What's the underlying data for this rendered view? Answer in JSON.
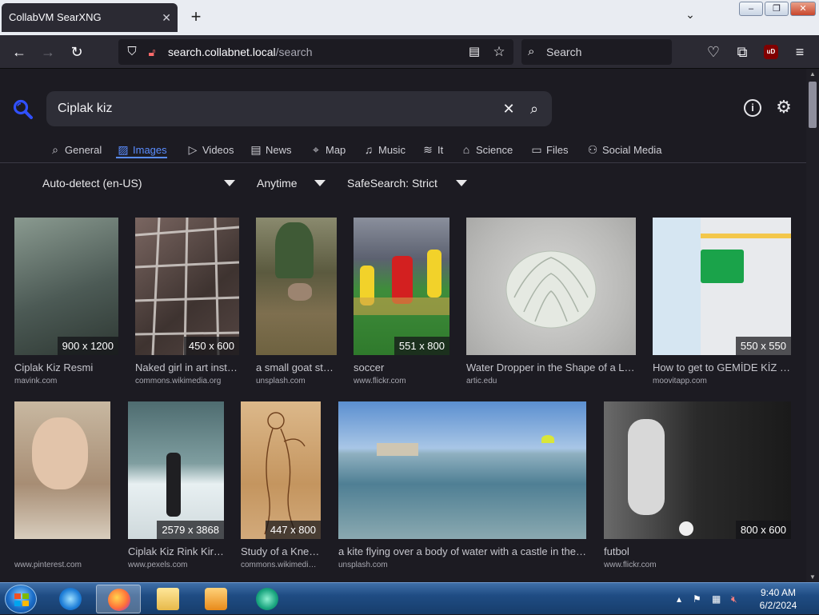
{
  "browser": {
    "tab_title": "CollabVM SearXNG",
    "tab_close": "✕",
    "new_tab": "+",
    "url_host": "search.collabnet.local",
    "url_path": "/search",
    "search_placeholder": "Search",
    "ublock_label": "uD"
  },
  "window_controls": {
    "minimize": "–",
    "restore": "❐",
    "close": "✕"
  },
  "search": {
    "query": "Ciplak kiz",
    "clear": "✕",
    "go": "⌕"
  },
  "categories": [
    {
      "label": "General",
      "icon": "search-icon",
      "glyph": "⌕"
    },
    {
      "label": "Images",
      "icon": "image-icon",
      "glyph": "▨"
    },
    {
      "label": "Videos",
      "icon": "play-icon",
      "glyph": "▷"
    },
    {
      "label": "News",
      "icon": "newspaper-icon",
      "glyph": "▤"
    },
    {
      "label": "Map",
      "icon": "map-pin-icon",
      "glyph": "⌖"
    },
    {
      "label": "Music",
      "icon": "music-icon",
      "glyph": "♫"
    },
    {
      "label": "It",
      "icon": "layers-icon",
      "glyph": "≋"
    },
    {
      "label": "Science",
      "icon": "graduation-icon",
      "glyph": "⌂"
    },
    {
      "label": "Files",
      "icon": "files-icon",
      "glyph": "▭"
    },
    {
      "label": "Social Media",
      "icon": "people-icon",
      "glyph": "⚇"
    }
  ],
  "active_category": "Images",
  "filters": {
    "language": "Auto-detect (en-US)",
    "time": "Anytime",
    "safesearch": "SafeSearch: Strict"
  },
  "results": [
    {
      "title": "Ciplak Kiz Resmi",
      "url": "mavink.com",
      "size": "900 x 1200",
      "color": "#5b6b63"
    },
    {
      "title": "Naked girl in art installation",
      "url": "commons.wikimedia.org",
      "size": "450 x 600",
      "color": "#6a5a55"
    },
    {
      "title": "a small goat standing in a field",
      "url": "unsplash.com",
      "size": "",
      "color": "#6e6647"
    },
    {
      "title": "soccer",
      "url": "www.flickr.com",
      "size": "551 x 800",
      "color": "#3e7a3a"
    },
    {
      "title": "Water Dropper in the Shape of a Lotus",
      "url": "artic.edu",
      "size": "",
      "color": "#c9c9c6"
    },
    {
      "title": "How to get to GEMİDE KİZ ÇIPLAK",
      "url": "moovitapp.com",
      "size": "550 x 550",
      "color": "#e7e9ec"
    },
    {
      "title": "",
      "url": "www.pinterest.com",
      "size": "",
      "color": "#bfa78e"
    },
    {
      "title": "Ciplak Kiz Rink Kiralama",
      "url": "www.pexels.com",
      "size": "2579 x 3868",
      "color": "#6e8a8c"
    },
    {
      "title": "Study of a Kneeling Woman",
      "url": "commons.wikimedia.org",
      "size": "447 x 800",
      "color": "#c49866"
    },
    {
      "title": "a kite flying over a body of water with a castle in the distance",
      "url": "unsplash.com",
      "size": "",
      "color": "#6b97ad"
    },
    {
      "title": "futbol",
      "url": "www.flickr.com",
      "size": "800 x 600",
      "color": "#3a3a3a"
    }
  ],
  "taskbar": {
    "time": "9:40 AM",
    "date": "6/2/2024"
  }
}
